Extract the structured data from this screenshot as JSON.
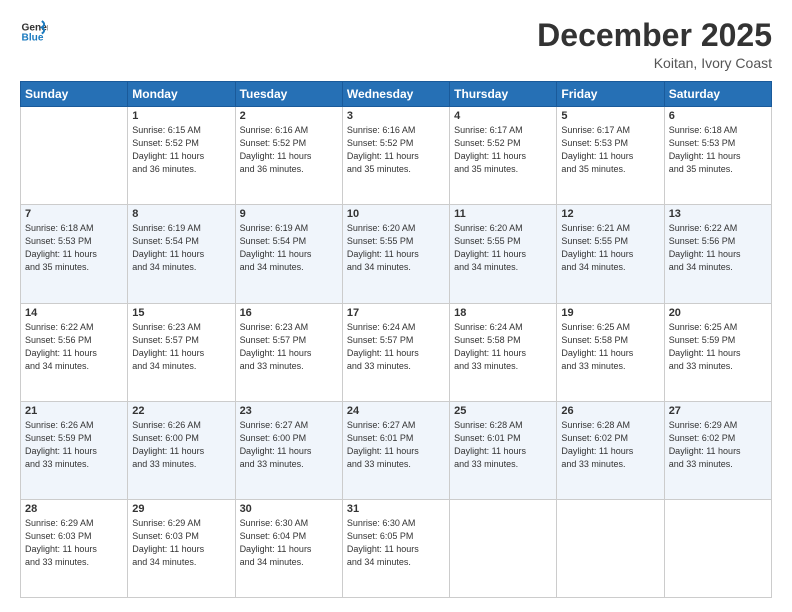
{
  "logo": {
    "line1": "General",
    "line2": "Blue"
  },
  "header": {
    "month": "December 2025",
    "location": "Koitan, Ivory Coast"
  },
  "weekdays": [
    "Sunday",
    "Monday",
    "Tuesday",
    "Wednesday",
    "Thursday",
    "Friday",
    "Saturday"
  ],
  "weeks": [
    [
      {
        "day": "",
        "info": ""
      },
      {
        "day": "1",
        "info": "Sunrise: 6:15 AM\nSunset: 5:52 PM\nDaylight: 11 hours\nand 36 minutes."
      },
      {
        "day": "2",
        "info": "Sunrise: 6:16 AM\nSunset: 5:52 PM\nDaylight: 11 hours\nand 36 minutes."
      },
      {
        "day": "3",
        "info": "Sunrise: 6:16 AM\nSunset: 5:52 PM\nDaylight: 11 hours\nand 35 minutes."
      },
      {
        "day": "4",
        "info": "Sunrise: 6:17 AM\nSunset: 5:52 PM\nDaylight: 11 hours\nand 35 minutes."
      },
      {
        "day": "5",
        "info": "Sunrise: 6:17 AM\nSunset: 5:53 PM\nDaylight: 11 hours\nand 35 minutes."
      },
      {
        "day": "6",
        "info": "Sunrise: 6:18 AM\nSunset: 5:53 PM\nDaylight: 11 hours\nand 35 minutes."
      }
    ],
    [
      {
        "day": "7",
        "info": "Sunrise: 6:18 AM\nSunset: 5:53 PM\nDaylight: 11 hours\nand 35 minutes."
      },
      {
        "day": "8",
        "info": "Sunrise: 6:19 AM\nSunset: 5:54 PM\nDaylight: 11 hours\nand 34 minutes."
      },
      {
        "day": "9",
        "info": "Sunrise: 6:19 AM\nSunset: 5:54 PM\nDaylight: 11 hours\nand 34 minutes."
      },
      {
        "day": "10",
        "info": "Sunrise: 6:20 AM\nSunset: 5:55 PM\nDaylight: 11 hours\nand 34 minutes."
      },
      {
        "day": "11",
        "info": "Sunrise: 6:20 AM\nSunset: 5:55 PM\nDaylight: 11 hours\nand 34 minutes."
      },
      {
        "day": "12",
        "info": "Sunrise: 6:21 AM\nSunset: 5:55 PM\nDaylight: 11 hours\nand 34 minutes."
      },
      {
        "day": "13",
        "info": "Sunrise: 6:22 AM\nSunset: 5:56 PM\nDaylight: 11 hours\nand 34 minutes."
      }
    ],
    [
      {
        "day": "14",
        "info": "Sunrise: 6:22 AM\nSunset: 5:56 PM\nDaylight: 11 hours\nand 34 minutes."
      },
      {
        "day": "15",
        "info": "Sunrise: 6:23 AM\nSunset: 5:57 PM\nDaylight: 11 hours\nand 34 minutes."
      },
      {
        "day": "16",
        "info": "Sunrise: 6:23 AM\nSunset: 5:57 PM\nDaylight: 11 hours\nand 33 minutes."
      },
      {
        "day": "17",
        "info": "Sunrise: 6:24 AM\nSunset: 5:57 PM\nDaylight: 11 hours\nand 33 minutes."
      },
      {
        "day": "18",
        "info": "Sunrise: 6:24 AM\nSunset: 5:58 PM\nDaylight: 11 hours\nand 33 minutes."
      },
      {
        "day": "19",
        "info": "Sunrise: 6:25 AM\nSunset: 5:58 PM\nDaylight: 11 hours\nand 33 minutes."
      },
      {
        "day": "20",
        "info": "Sunrise: 6:25 AM\nSunset: 5:59 PM\nDaylight: 11 hours\nand 33 minutes."
      }
    ],
    [
      {
        "day": "21",
        "info": "Sunrise: 6:26 AM\nSunset: 5:59 PM\nDaylight: 11 hours\nand 33 minutes."
      },
      {
        "day": "22",
        "info": "Sunrise: 6:26 AM\nSunset: 6:00 PM\nDaylight: 11 hours\nand 33 minutes."
      },
      {
        "day": "23",
        "info": "Sunrise: 6:27 AM\nSunset: 6:00 PM\nDaylight: 11 hours\nand 33 minutes."
      },
      {
        "day": "24",
        "info": "Sunrise: 6:27 AM\nSunset: 6:01 PM\nDaylight: 11 hours\nand 33 minutes."
      },
      {
        "day": "25",
        "info": "Sunrise: 6:28 AM\nSunset: 6:01 PM\nDaylight: 11 hours\nand 33 minutes."
      },
      {
        "day": "26",
        "info": "Sunrise: 6:28 AM\nSunset: 6:02 PM\nDaylight: 11 hours\nand 33 minutes."
      },
      {
        "day": "27",
        "info": "Sunrise: 6:29 AM\nSunset: 6:02 PM\nDaylight: 11 hours\nand 33 minutes."
      }
    ],
    [
      {
        "day": "28",
        "info": "Sunrise: 6:29 AM\nSunset: 6:03 PM\nDaylight: 11 hours\nand 33 minutes."
      },
      {
        "day": "29",
        "info": "Sunrise: 6:29 AM\nSunset: 6:03 PM\nDaylight: 11 hours\nand 34 minutes."
      },
      {
        "day": "30",
        "info": "Sunrise: 6:30 AM\nSunset: 6:04 PM\nDaylight: 11 hours\nand 34 minutes."
      },
      {
        "day": "31",
        "info": "Sunrise: 6:30 AM\nSunset: 6:05 PM\nDaylight: 11 hours\nand 34 minutes."
      },
      {
        "day": "",
        "info": ""
      },
      {
        "day": "",
        "info": ""
      },
      {
        "day": "",
        "info": ""
      }
    ]
  ]
}
